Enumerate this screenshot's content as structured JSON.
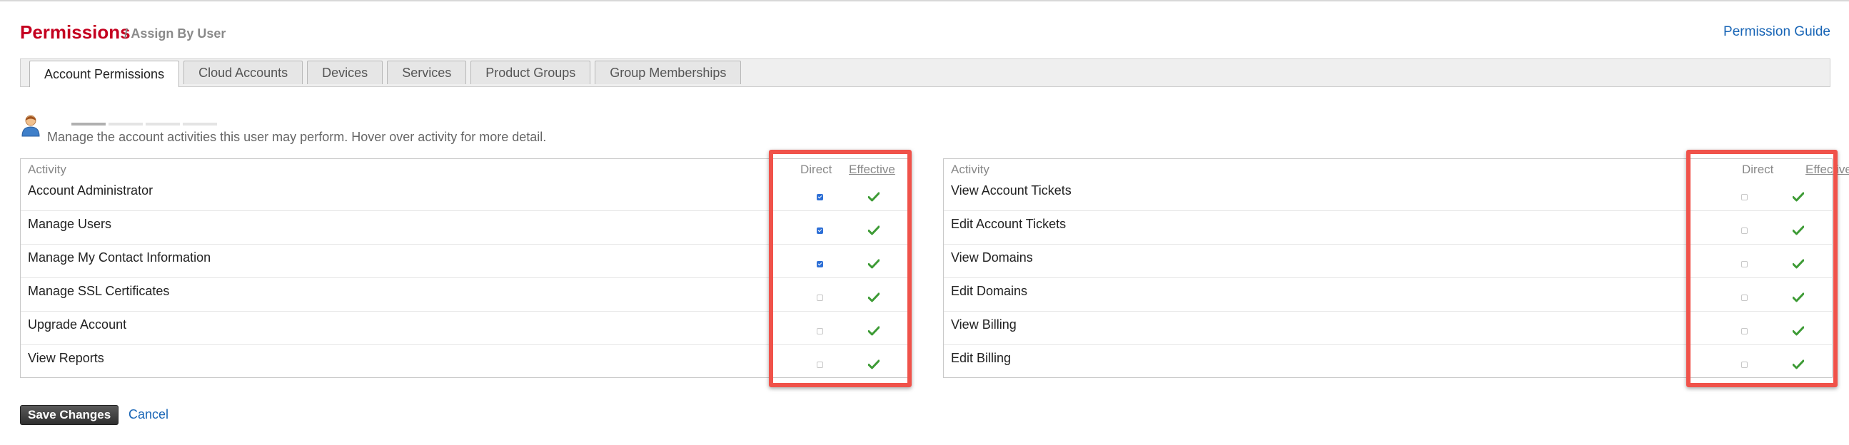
{
  "header": {
    "title": "Permissions",
    "subtitle": "/ Assign By User",
    "guide_link": "Permission Guide"
  },
  "tabs": [
    {
      "label": "Account Permissions",
      "active": true
    },
    {
      "label": "Cloud Accounts",
      "active": false
    },
    {
      "label": "Devices",
      "active": false
    },
    {
      "label": "Services",
      "active": false
    },
    {
      "label": "Product Groups",
      "active": false
    },
    {
      "label": "Group Memberships",
      "active": false
    }
  ],
  "description": "Manage the account activities this user may perform. Hover over activity for more detail.",
  "columns": {
    "activity": "Activity",
    "direct": "Direct",
    "effective": "Effective"
  },
  "left_table": {
    "rows": [
      {
        "label": "Account Administrator",
        "direct": true,
        "effective": true
      },
      {
        "label": "Manage Users",
        "direct": true,
        "effective": true
      },
      {
        "label": "Manage My Contact Information",
        "direct": true,
        "effective": true
      },
      {
        "label": "Manage SSL Certificates",
        "direct": false,
        "effective": true
      },
      {
        "label": "Upgrade Account",
        "direct": false,
        "effective": true
      },
      {
        "label": "View Reports",
        "direct": false,
        "effective": true
      }
    ]
  },
  "right_table": {
    "rows": [
      {
        "label": "View Account Tickets",
        "direct": false,
        "effective": true
      },
      {
        "label": "Edit Account Tickets",
        "direct": false,
        "effective": true
      },
      {
        "label": "View Domains",
        "direct": false,
        "effective": true
      },
      {
        "label": "Edit Domains",
        "direct": false,
        "effective": true
      },
      {
        "label": "View Billing",
        "direct": false,
        "effective": true
      },
      {
        "label": "Edit Billing",
        "direct": false,
        "effective": true
      }
    ]
  },
  "footer": {
    "save_label": "Save Changes",
    "cancel_label": "Cancel"
  },
  "colors": {
    "title_red": "#c4001f",
    "link_blue": "#1865b6",
    "check_green": "#3d9b35",
    "highlight_red": "#f0524a"
  },
  "icons": {
    "user": "user-icon",
    "check": "check-icon"
  }
}
